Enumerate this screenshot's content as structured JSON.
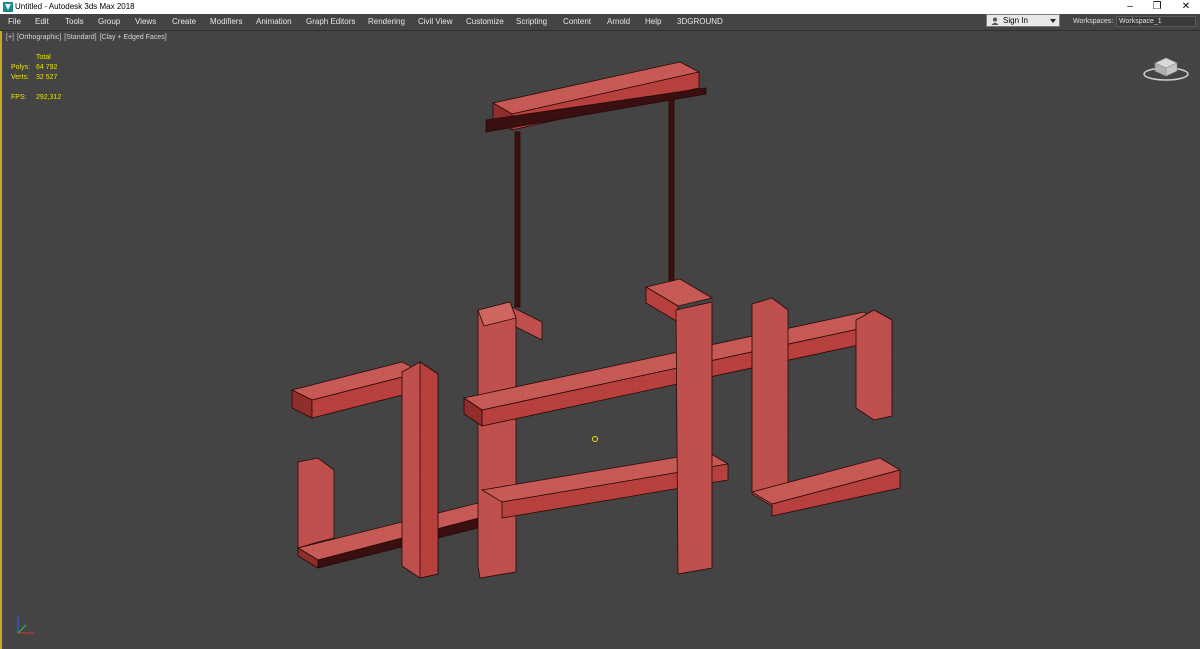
{
  "window": {
    "title": "Untitled - Autodesk 3ds Max 2018",
    "minimize": "–",
    "maximize": "❐",
    "close": "✕"
  },
  "menu": [
    {
      "label": "File"
    },
    {
      "label": "Edit"
    },
    {
      "label": "Tools"
    },
    {
      "label": "Group"
    },
    {
      "label": "Views"
    },
    {
      "label": "Create"
    },
    {
      "label": "Modifiers"
    },
    {
      "label": "Animation"
    },
    {
      "label": "Graph Editors"
    },
    {
      "label": "Rendering"
    },
    {
      "label": "Civil View"
    },
    {
      "label": "Customize"
    },
    {
      "label": "Scripting"
    },
    {
      "label": "Content"
    },
    {
      "label": "Arnold"
    },
    {
      "label": "Help"
    },
    {
      "label": "3DGROUND"
    }
  ],
  "account": {
    "signin_label": "Sign In"
  },
  "workspaces": {
    "label": "Workspaces:",
    "value": "Workspace_1"
  },
  "viewport": {
    "menus": [
      "[+]",
      "[Orthographic]",
      "[Standard]",
      "[Clay + Edged Faces]"
    ],
    "stats": {
      "header": "Total",
      "polys_label": "Polys:",
      "polys_value": "64 792",
      "verts_label": "Verts:",
      "verts_value": "32 527",
      "fps_label": "FPS:",
      "fps_value": "292,312"
    },
    "viewcube_face": "left"
  },
  "colors": {
    "viewport_bg": "#444444",
    "object_fill": "#c0504d",
    "object_shadow": "#3a0f0f",
    "active_border": "#c8a91e",
    "stats_text": "#e8e400"
  }
}
